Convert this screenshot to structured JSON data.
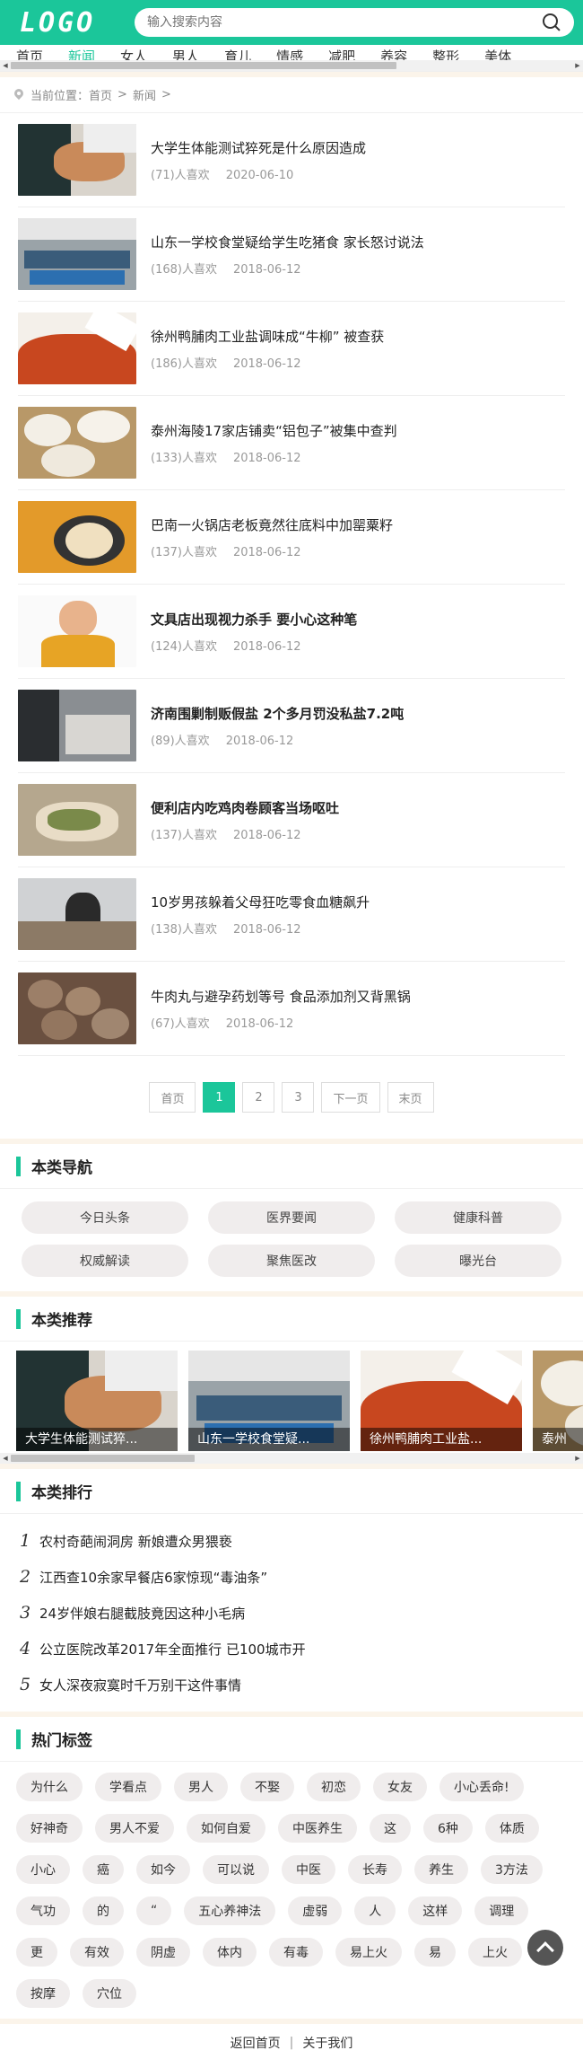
{
  "header": {
    "logo": "LOGO",
    "search_placeholder": "输入搜索内容"
  },
  "nav": {
    "items": [
      "首页",
      "新闻",
      "女人",
      "男人",
      "育儿",
      "情感",
      "减肥",
      "养容",
      "整形",
      "美体"
    ],
    "active_index": 1
  },
  "breadcrumb": {
    "label": "当前位置：",
    "home": "首页",
    "sep1": ">",
    "current": "新闻",
    "sep2": ">"
  },
  "news": [
    {
      "title": "大学生体能测试猝死是什么原因造成",
      "likes": "(71)人喜欢",
      "date": "2020-06-10",
      "bold": false,
      "thumb": "hands-bread"
    },
    {
      "title": "山东一学校食堂疑给学生吃猪食 家长怒讨说法",
      "likes": "(168)人喜欢",
      "date": "2018-06-12",
      "bold": false,
      "thumb": "canteen"
    },
    {
      "title": "徐州鸭脯肉工业盐调味成“牛柳” 被查获",
      "likes": "(186)人喜欢",
      "date": "2018-06-12",
      "bold": false,
      "thumb": "meat"
    },
    {
      "title": "泰州海陵17家店铺卖“铝包子”被集中查判",
      "likes": "(133)人喜欢",
      "date": "2018-06-12",
      "bold": false,
      "thumb": "buns"
    },
    {
      "title": "巴南一火锅店老板竟然往底料中加罂粟籽",
      "likes": "(137)人喜欢",
      "date": "2018-06-12",
      "bold": false,
      "thumb": "hotpot"
    },
    {
      "title": "文具店出现视力杀手 要小心这种笔",
      "likes": "(124)人喜欢",
      "date": "2018-06-12",
      "bold": true,
      "thumb": "boy"
    },
    {
      "title": "济南围剿制贩假盐 2个多月罚没私盐7.2吨",
      "likes": "(89)人喜欢",
      "date": "2018-06-12",
      "bold": true,
      "thumb": "salt"
    },
    {
      "title": "便利店内吃鸡肉卷顾客当场呕吐",
      "likes": "(137)人喜欢",
      "date": "2018-06-12",
      "bold": true,
      "thumb": "chicken"
    },
    {
      "title": "10岁男孩躲着父母狂吃零食血糖飙升",
      "likes": "(138)人喜欢",
      "date": "2018-06-12",
      "bold": false,
      "thumb": "office"
    },
    {
      "title": "牛肉丸与避孕药划等号 食品添加剂又背黑锅",
      "likes": "(67)人喜欢",
      "date": "2018-06-12",
      "bold": false,
      "thumb": "meatballs"
    }
  ],
  "pagination": {
    "first": "首页",
    "pages": [
      "1",
      "2",
      "3"
    ],
    "active": "1",
    "next": "下一页",
    "last": "末页"
  },
  "category_nav": {
    "title": "本类导航",
    "items": [
      "今日头条",
      "医界要闻",
      "健康科普",
      "权威解读",
      "聚焦医改",
      "曝光台"
    ]
  },
  "recommend": {
    "title": "本类推荐",
    "items": [
      {
        "caption": "大学生体能测试猝...",
        "thumb": "hands-bread"
      },
      {
        "caption": "山东一学校食堂疑...",
        "thumb": "canteen"
      },
      {
        "caption": "徐州鸭脯肉工业盐...",
        "thumb": "meat"
      },
      {
        "caption": "泰州",
        "thumb": "buns"
      }
    ]
  },
  "ranking": {
    "title": "本类排行",
    "items": [
      {
        "num": "1",
        "text": "农村奇葩闹洞房 新娘遭众男猥亵"
      },
      {
        "num": "2",
        "text": "江西查10余家早餐店6家惊现“毒油条”"
      },
      {
        "num": "3",
        "text": "24岁伴娘右腿截肢竟因这种小毛病"
      },
      {
        "num": "4",
        "text": "公立医院改革2017年全面推行 已100城市开"
      },
      {
        "num": "5",
        "text": "女人深夜寂寞时千万别干这件事情"
      }
    ]
  },
  "hot_tags": {
    "title": "热门标签",
    "items": [
      "为什么",
      "学看点",
      "男人",
      "不娶",
      "初恋",
      "女友",
      "小心丢命!",
      "好神奇",
      "男人不爱",
      "如何自爱",
      "中医养生",
      "这",
      "6种",
      "体质",
      "小心",
      "癌",
      "如今",
      "可以说",
      "中医",
      "长寿",
      "养生",
      "3方法",
      "气功",
      "的",
      "“",
      "五心养神法",
      "虚弱",
      "人",
      "这样",
      "调理",
      "更",
      "有效",
      "阴虚",
      "体内",
      "有毒",
      "易上火",
      "易",
      "上火",
      "按摩",
      "穴位"
    ]
  },
  "footer": {
    "home": "返回首页",
    "sep": "|",
    "about": "关于我们"
  },
  "colors": {
    "accent": "#1bc69a",
    "divider": "#fbf4ea",
    "tag_bg": "#f0eded"
  }
}
